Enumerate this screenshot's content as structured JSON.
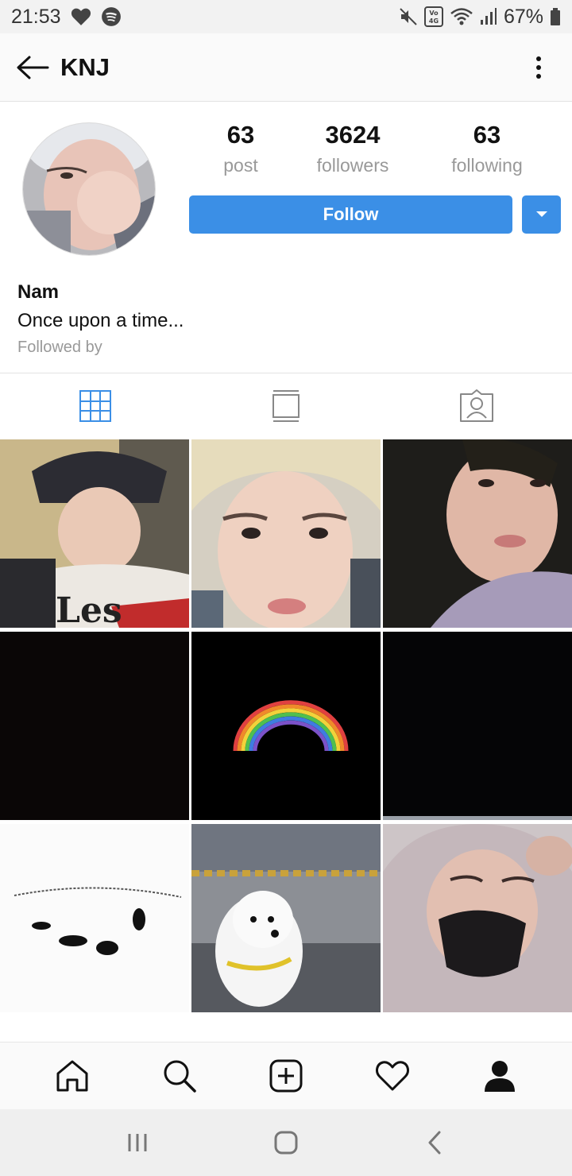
{
  "status_bar": {
    "time": "21:53",
    "battery": "67%",
    "icons_left": [
      "heart-icon",
      "spotify-icon"
    ],
    "icons_right": [
      "mute-icon",
      "volte-icon",
      "wifi-icon",
      "signal-icon",
      "battery-icon"
    ]
  },
  "header": {
    "title": "KNJ",
    "back_icon": "arrow-left-icon",
    "menu_icon": "more-vertical-icon"
  },
  "profile": {
    "stats": [
      {
        "value": "63",
        "label": "post"
      },
      {
        "value": "3624",
        "label": "followers"
      },
      {
        "value": "63",
        "label": "following"
      }
    ],
    "follow_label": "Follow",
    "name": "Nam",
    "bio": "Once upon a time...",
    "followed_by": "Followed by"
  },
  "tabs": [
    {
      "icon": "grid-icon",
      "active": true
    },
    {
      "icon": "feed-icon",
      "active": false
    },
    {
      "icon": "tagged-icon",
      "active": false
    }
  ],
  "grid": {
    "posts": [
      {
        "description": "selfie bucket hat"
      },
      {
        "description": "blonde close-up selfie"
      },
      {
        "description": "dark car selfie"
      },
      {
        "description": "black image"
      },
      {
        "description": "rainbow on black"
      },
      {
        "description": "black image"
      },
      {
        "description": "peter pan silhouette text"
      },
      {
        "description": "white dog on pavement"
      },
      {
        "description": "hoodie mask selfie"
      }
    ]
  },
  "bottom_nav": [
    "home-icon",
    "search-icon",
    "add-post-icon",
    "activity-heart-icon",
    "profile-icon"
  ],
  "system_nav": [
    "recents-icon",
    "home-button-icon",
    "back-icon"
  ],
  "colors": {
    "accent": "#3b8fe6",
    "status_bar_bg": "#f2f2f2",
    "secondary_text": "#999999"
  }
}
